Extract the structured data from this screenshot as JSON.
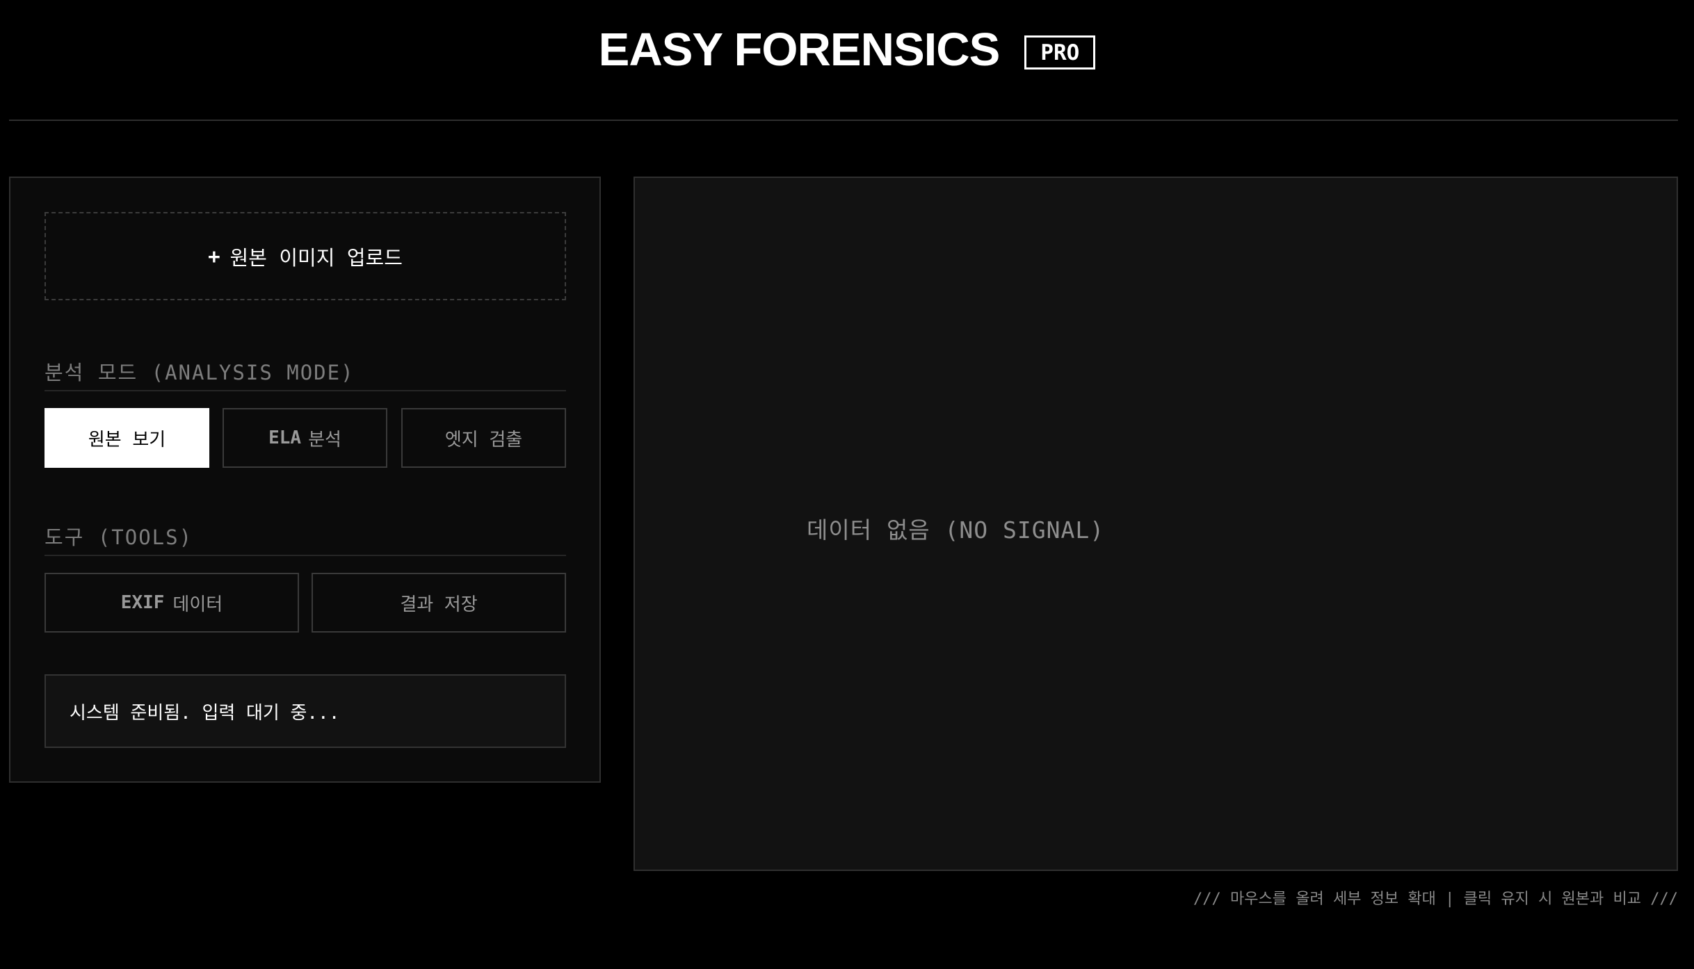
{
  "header": {
    "title": "EASY FORENSICS",
    "badge": "PRO"
  },
  "controls": {
    "upload_plus": "+",
    "upload_label": "원본 이미지 업로드",
    "analysis_mode_label": "분석 모드 (ANALYSIS MODE)",
    "modes": [
      {
        "label": "원본 보기",
        "active": true
      },
      {
        "prefix": "ELA",
        "label": "분석",
        "active": false
      },
      {
        "label": "엣지 검출",
        "active": false
      }
    ],
    "tools_label": "도구 (TOOLS)",
    "tools": [
      {
        "prefix": "EXIF",
        "label": "데이터"
      },
      {
        "label": "결과 저장"
      }
    ],
    "status": "시스템 준비됨. 입력 대기 중..."
  },
  "viewer": {
    "placeholder": "데이터 없음 (NO SIGNAL)"
  },
  "footer": {
    "hint": "/// 마우스를 올려 세부 정보 확대 | 클릭 유지 시 원본과 비교 ///"
  },
  "colors": {
    "background": "#000000",
    "panel": "#0b0b0b",
    "viewer": "#121212",
    "active_button": "#ffffff",
    "muted_text": "#7d7d7d"
  }
}
